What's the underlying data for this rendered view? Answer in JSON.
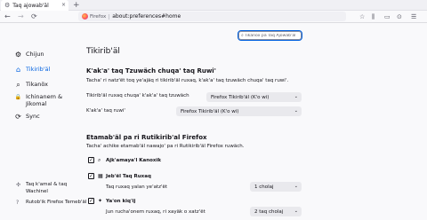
{
  "tab": {
    "title": "Taq ajowab'äl",
    "gear_icon": "gear-icon",
    "close": "×"
  },
  "newtab": "+",
  "toolbar": {
    "back": "←",
    "forward": "→",
    "reload": "⟳",
    "url_brand": "Firefox",
    "url": "about:preferences#home",
    "right_icons": [
      "☆",
      "⫼",
      "▭",
      "⊙",
      "☰"
    ]
  },
  "search": {
    "placeholder": "Tikanöx pa Taq Ajowab'äl"
  },
  "sidebar": {
    "items": [
      {
        "label": "Chijun",
        "icon": "⚙"
      },
      {
        "label": "Tikirib'äl",
        "icon": "⌂"
      },
      {
        "label": "Tikanöx",
        "icon": "⌕"
      },
      {
        "label": "Ichinanem &\nJikomal",
        "icon": "🔒"
      },
      {
        "label": "Sync",
        "icon": "⟳"
      }
    ],
    "footer": [
      {
        "label": "Taq k'amal & taq\nWachinel",
        "icon": "✣"
      },
      {
        "label": "Rutob'ik Firefox Temeb'äl",
        "icon": "?"
      }
    ]
  },
  "main": {
    "title": "Tikirib'äl",
    "section1": {
      "heading": "K'ak'a' taq Tzuwäch chuqa' taq Ruwi'",
      "desc": "Tacha' ri natz'ët toq ye'ajäq ri tikirib'äl ruxaq, k'ak'a' taq tzuwäch chuqa' taq ruwi'.",
      "rows": [
        {
          "label": "Tikirib'äl ruxaq chuqa' k'ak'a' taq tzuwäch",
          "value": "Firefox Tikirib'äl (K'o wi)"
        },
        {
          "label": "K'ak'a' taq ruwi'",
          "value": "Firefox Tikirib'äl (K'o wi)"
        }
      ]
    },
    "section2": {
      "heading": "Etamab'äl pa ri Rutikirib'al Firefox",
      "desc": "Tacha' achike etamab'äl nawajo' pa ri Rutikirib'äl Firefox ruwäch.",
      "items": [
        {
          "label": "Ajk'amaya'l Kanoxïk",
          "icon": "⌕",
          "check": "✓"
        },
        {
          "label": "Jeb'ël Taq Ruxaq",
          "icon": "▦",
          "check": "✓",
          "sublabel": "Taq ruxaq yalan ye'atz'ët",
          "value": "1 cholaj"
        },
        {
          "label": "Ya'on kiq'ij",
          "icon": "✦",
          "check": "✓",
          "sublabel": "Jun rucha'onem ruxaq, ri xayäk o xatz'ët",
          "value": "2 taq cholaj"
        }
      ]
    }
  }
}
